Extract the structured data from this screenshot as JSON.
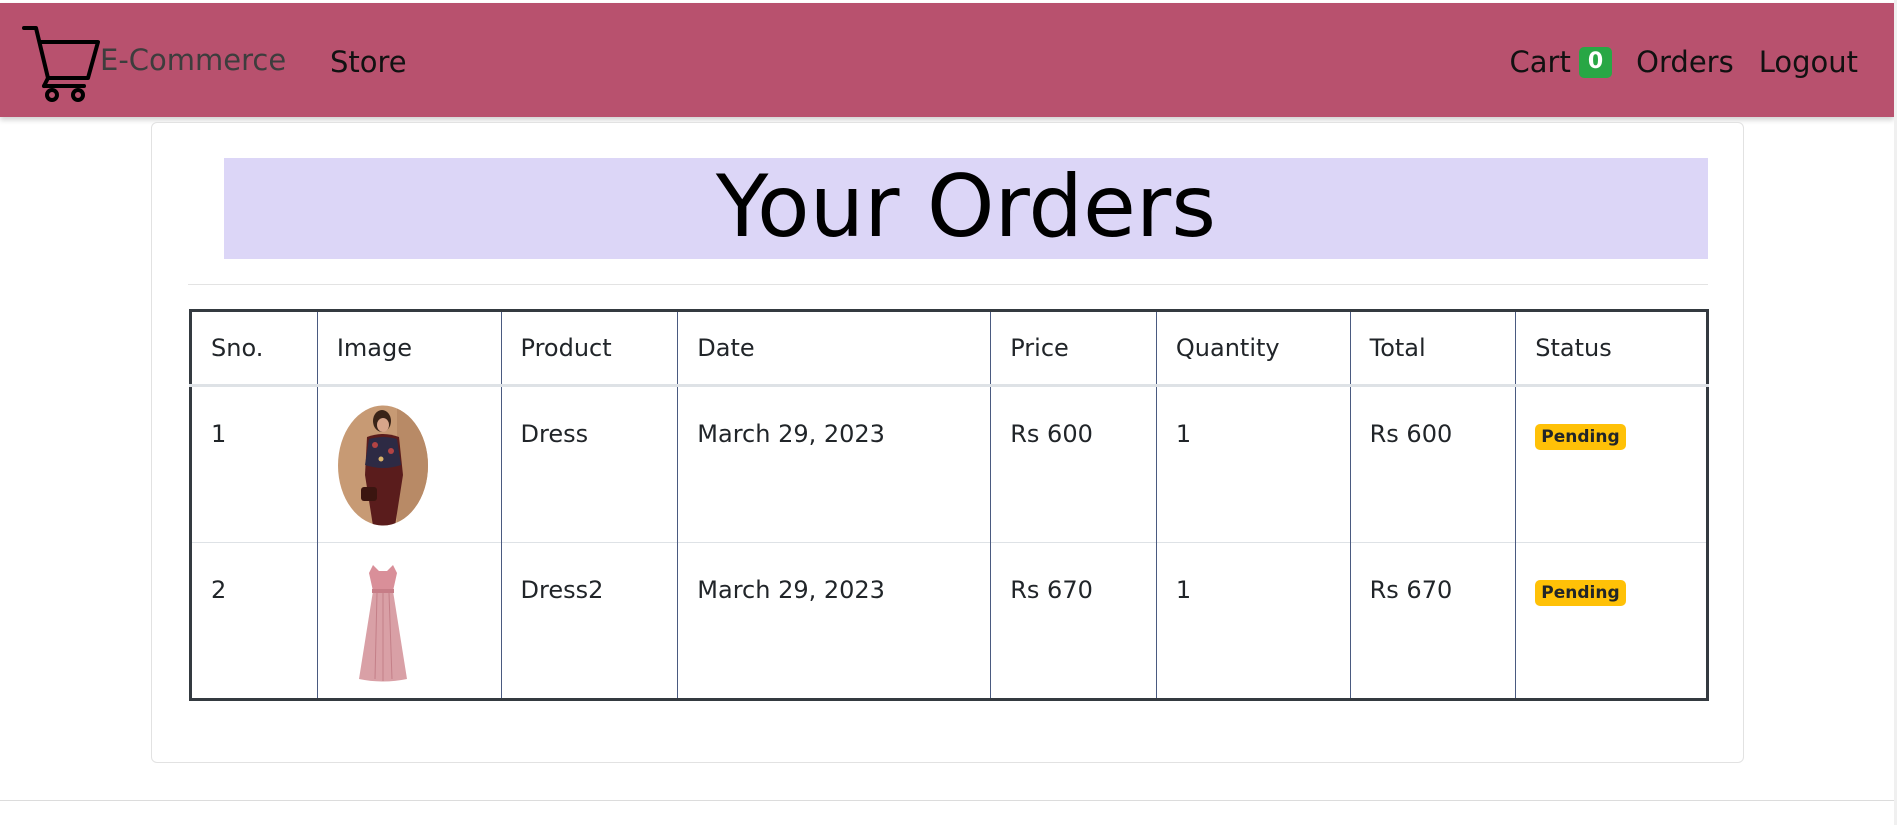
{
  "navbar": {
    "brand": "E-Commerce",
    "store": "Store",
    "cart_label": "Cart",
    "cart_count": "0",
    "orders": "Orders",
    "logout": "Logout",
    "bg_color": "#b8516e"
  },
  "page": {
    "title": "Your Orders"
  },
  "table": {
    "headers": [
      "Sno.",
      "Image",
      "Product",
      "Date",
      "Price",
      "Quantity",
      "Total",
      "Status"
    ],
    "rows": [
      {
        "sno": "1",
        "image": "woman-in-dress-photo",
        "product": "Dress",
        "date": "March 29, 2023",
        "price": "Rs 600",
        "quantity": "1",
        "total": "Rs 600",
        "status": "Pending"
      },
      {
        "sno": "2",
        "image": "pink-gown-photo",
        "product": "Dress2",
        "date": "March 29, 2023",
        "price": "Rs 670",
        "quantity": "1",
        "total": "Rs 670",
        "status": "Pending"
      }
    ]
  },
  "colors": {
    "navbar": "#b8516e",
    "heading_bg": "#dcd6f7",
    "cart_badge": "#28a745",
    "status_pending": "#ffc107"
  }
}
